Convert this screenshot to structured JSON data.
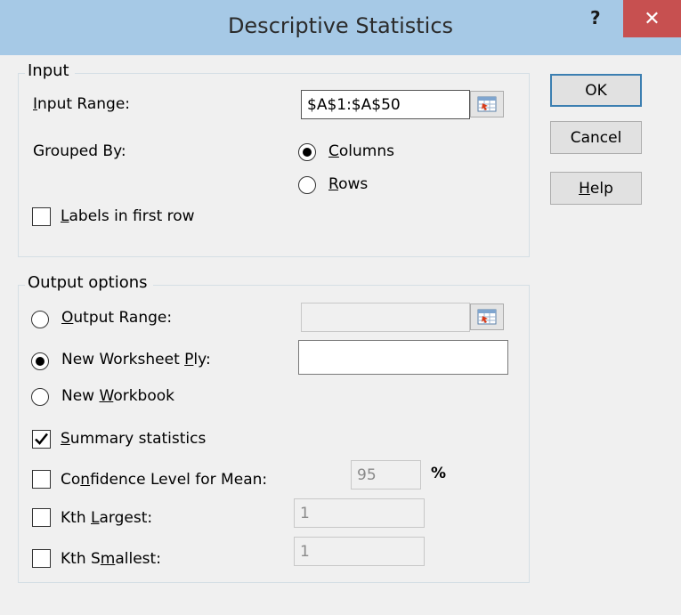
{
  "window": {
    "title": "Descriptive Statistics",
    "help_glyph": "?",
    "close_glyph": "✕"
  },
  "input_group": {
    "label": "Input",
    "input_range": {
      "label": "Input Range:",
      "value": "$A$1:$A$50"
    },
    "grouped_by": {
      "label": "Grouped By:",
      "options": [
        {
          "label": "Columns",
          "selected": true
        },
        {
          "label": "Rows",
          "selected": false
        }
      ]
    },
    "labels_first_row": {
      "label": "Labels in first row",
      "checked": false
    }
  },
  "output_group": {
    "label": "Output options",
    "output_range": {
      "label": "Output Range:",
      "selected": false,
      "value": ""
    },
    "new_worksheet": {
      "label": "New Worksheet Ply:",
      "selected": true,
      "value": ""
    },
    "new_workbook": {
      "label": "New Workbook",
      "selected": false
    },
    "summary_statistics": {
      "label": "Summary statistics",
      "checked": true
    },
    "confidence_level": {
      "label": "Confidence Level for Mean:",
      "checked": false,
      "value": "95",
      "unit": "%"
    },
    "kth_largest": {
      "label": "Kth Largest:",
      "checked": false,
      "value": "1"
    },
    "kth_smallest": {
      "label": "Kth Smallest:",
      "checked": false,
      "value": "1"
    }
  },
  "buttons": {
    "ok": "OK",
    "cancel": "Cancel",
    "help": "Help"
  },
  "colors": {
    "titlebar": "#a6c9e6",
    "close_button": "#c75050",
    "dialog_background": "#f0f0f0"
  }
}
